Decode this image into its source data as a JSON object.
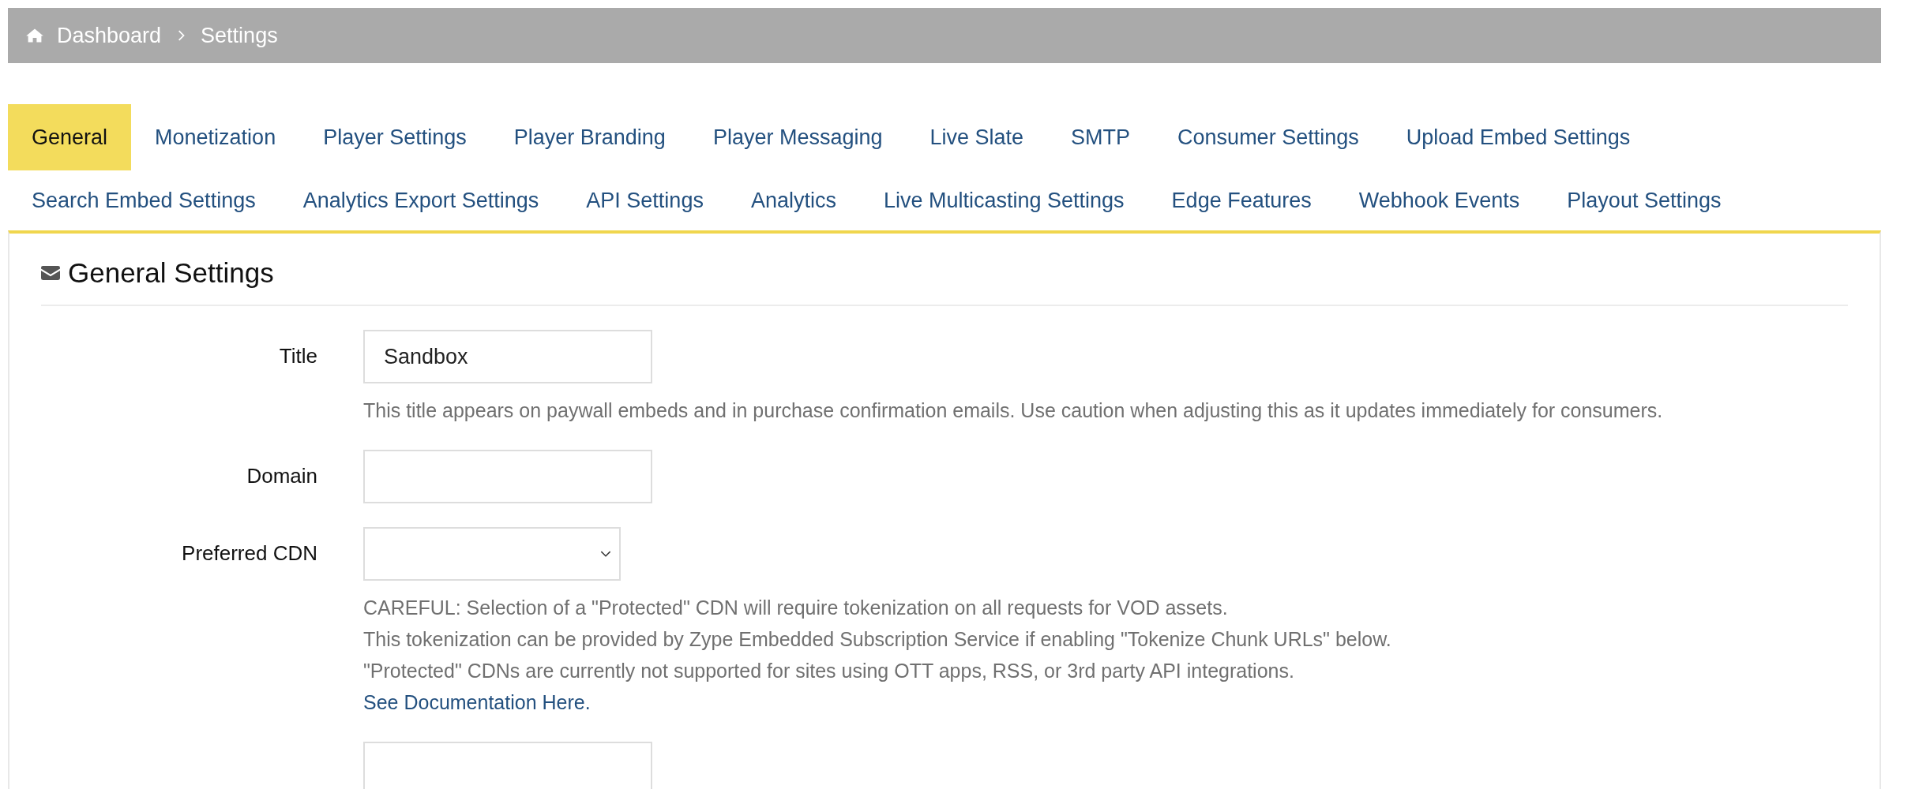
{
  "breadcrumb": {
    "items": [
      "Dashboard",
      "Settings"
    ]
  },
  "tab_rows": [
    [
      {
        "label": "General",
        "selected": true
      },
      {
        "label": "Monetization",
        "selected": false
      },
      {
        "label": "Player Settings",
        "selected": false
      },
      {
        "label": "Player Branding",
        "selected": false
      },
      {
        "label": "Player Messaging",
        "selected": false
      },
      {
        "label": "Live Slate",
        "selected": false
      },
      {
        "label": "SMTP",
        "selected": false
      },
      {
        "label": "Consumer Settings",
        "selected": false
      },
      {
        "label": "Upload Embed Settings",
        "selected": false
      }
    ],
    [
      {
        "label": "Search Embed Settings",
        "selected": false
      },
      {
        "label": "Analytics Export Settings",
        "selected": false
      },
      {
        "label": "API Settings",
        "selected": false
      },
      {
        "label": "Analytics",
        "selected": false
      },
      {
        "label": "Live Multicasting Settings",
        "selected": false
      },
      {
        "label": "Edge Features",
        "selected": false
      },
      {
        "label": "Webhook Events",
        "selected": false
      },
      {
        "label": "Playout Settings",
        "selected": false
      }
    ]
  ],
  "panel": {
    "heading": "General Settings",
    "fields": [
      {
        "kind": "text",
        "label": "Title",
        "value": "Sandbox",
        "help": [
          "This title appears on paywall embeds and in purchase confirmation emails. Use caution when adjusting this as it updates immediately for consumers."
        ]
      },
      {
        "kind": "text",
        "label": "Domain"
      },
      {
        "kind": "select",
        "label": "Preferred CDN",
        "help": [
          "CAREFUL: Selection of a \"Protected\" CDN will require tokenization on all requests for VOD assets.",
          "This tokenization can be provided by Zype Embedded Subscription Service if enabling \"Tokenize Chunk URLs\" below.",
          "\"Protected\" CDNs are currently not supported for sites using OTT apps, RSS, or 3rd party API integrations."
        ],
        "link": "See Documentation Here."
      },
      {
        "kind": "text"
      }
    ]
  }
}
